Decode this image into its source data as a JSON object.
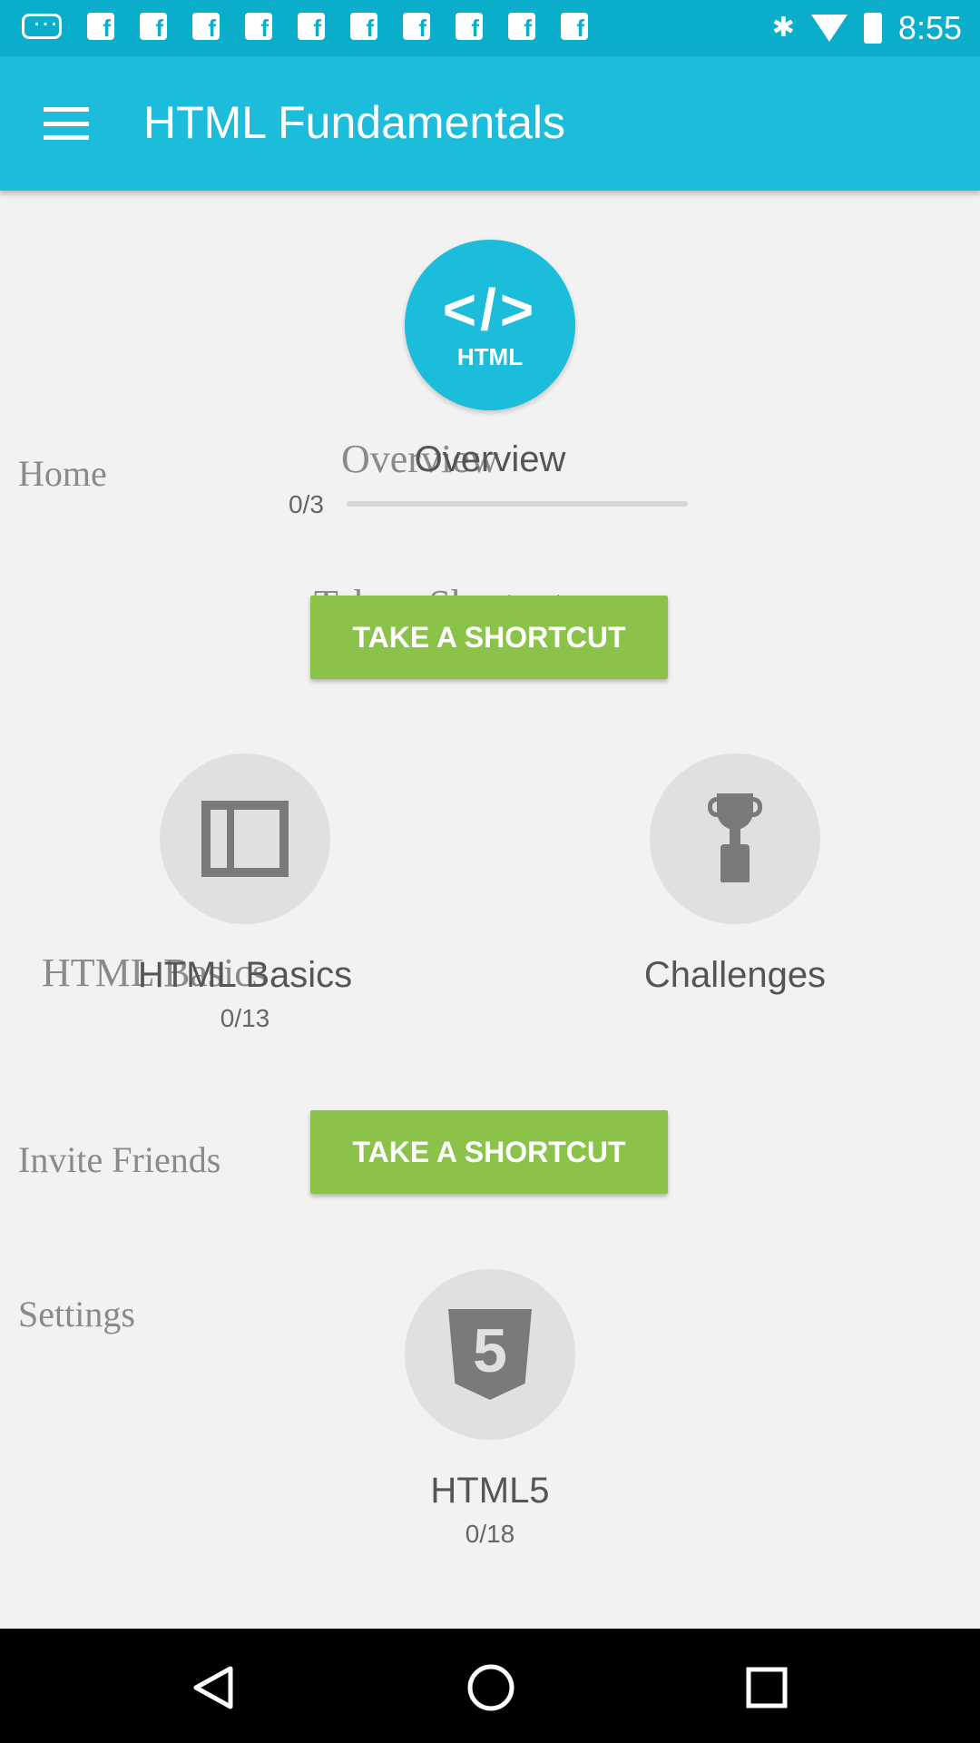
{
  "status_bar": {
    "time": "8:55",
    "left_icons": [
      "more-dots-icon",
      "facebook-icon",
      "facebook-icon",
      "facebook-icon",
      "facebook-icon",
      "facebook-icon",
      "facebook-icon",
      "facebook-icon",
      "facebook-icon",
      "facebook-icon",
      "facebook-icon"
    ],
    "right_icons": [
      "bluetooth-icon",
      "wifi-icon",
      "battery-icon"
    ]
  },
  "app_bar": {
    "title": "HTML Fundamentals",
    "menu_icon": "menu-icon"
  },
  "drawer": {
    "items": [
      {
        "label": "Home"
      },
      {
        "label": "Take a Shortcut"
      },
      {
        "label": "HTML Basics"
      },
      {
        "label": "Invite Friends"
      },
      {
        "label": "Settings"
      }
    ],
    "ghost_overview": "Overview"
  },
  "courses": {
    "overview": {
      "icon": "html-code-icon",
      "icon_text": "</>",
      "icon_sub": "HTML",
      "title": "Overview",
      "progress_text": "0/3",
      "progress": 0
    },
    "shortcut_button_1": "TAKE A SHORTCUT",
    "basics": {
      "icon": "layout-icon",
      "title": "HTML Basics",
      "progress_text": "0/13"
    },
    "challenges": {
      "icon": "trophy-icon",
      "title": "Challenges"
    },
    "shortcut_button_2": "TAKE A SHORTCUT",
    "html5": {
      "icon": "html5-shield-icon",
      "icon_text": "5",
      "title": "HTML5",
      "progress_text": "0/18"
    }
  },
  "nav_bar": {
    "icons": [
      "back-icon",
      "home-icon",
      "recents-icon"
    ]
  }
}
